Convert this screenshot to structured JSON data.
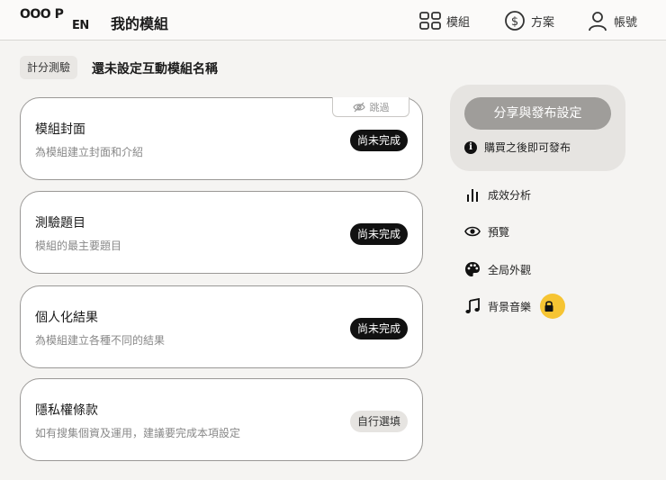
{
  "header": {
    "logo_line1": "OOO P",
    "logo_line2": "EN",
    "app_title": "我的模組",
    "nav": {
      "modules": "模組",
      "plans": "方案",
      "account": "帳號"
    }
  },
  "module": {
    "tag": "計分測驗",
    "name": "還未設定互動模組名稱"
  },
  "cards": [
    {
      "title": "模組封面",
      "subtitle": "為模組建立封面和介紹",
      "status": "尚未完成",
      "skip_label": "跳過"
    },
    {
      "title": "測驗題目",
      "subtitle": "模組的最主要題目",
      "status": "尚未完成"
    },
    {
      "title": "個人化結果",
      "subtitle": "為模組建立各種不同的結果",
      "status": "尚未完成"
    },
    {
      "title": "隱私權條款",
      "subtitle": "如有搜集個資及運用，建議要完成本項設定",
      "status": "自行選填"
    }
  ],
  "sidebar": {
    "share_button": "分享與發布設定",
    "share_note": "購買之後即可發布",
    "items": [
      {
        "label": "成效分析",
        "icon": "bar-chart-icon"
      },
      {
        "label": "預覽",
        "icon": "eye-icon"
      },
      {
        "label": "全局外觀",
        "icon": "palette-icon"
      },
      {
        "label": "背景音樂",
        "icon": "music-icon",
        "locked": true
      }
    ]
  },
  "colors": {
    "lock_accent": "#f6c433",
    "badge_dark": "#111111",
    "disabled_button": "#9f9d9a"
  }
}
